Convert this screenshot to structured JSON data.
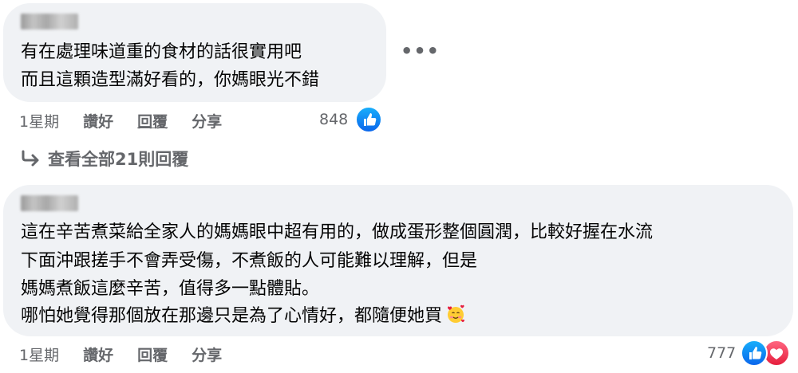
{
  "colors": {
    "bubble_bg": "#f0f2f5",
    "meta_text": "#65676b",
    "like_blue": "#1877f2",
    "love_red": "#f33e58"
  },
  "comments": [
    {
      "author_name_blurred": true,
      "lines": [
        "有在處理味道重的食材的話很實用吧",
        "而且這顆造型滿好看的，你媽眼光不錯"
      ],
      "time": "1星期",
      "like_label": "讚好",
      "reply_label": "回覆",
      "share_label": "分享",
      "reaction_count": "848",
      "reactions": [
        "like-icon"
      ],
      "more_icon": "more-options-icon"
    },
    {
      "author_name_blurred": true,
      "lines": [
        "這在辛苦煮菜給全家人的媽媽眼中超有用的，做成蛋形整個圓潤，比較好握在水流",
        "下面沖跟搓手不會弄受傷，不煮飯的人可能難以理解，但是",
        "媽媽煮飯這麼辛苦，值得多一點體貼。",
        "哪怕她覺得那個放在那邊只是為了心情好，都隨便她買"
      ],
      "emoji": "smiling-face-with-hearts-emoji",
      "time": "1星期",
      "like_label": "讚好",
      "reply_label": "回覆",
      "share_label": "分享",
      "reaction_count": "777",
      "reactions": [
        "like-icon",
        "love-icon"
      ]
    }
  ],
  "view_replies": {
    "icon": "reply-arrow-icon",
    "label": "查看全部21則回覆"
  }
}
